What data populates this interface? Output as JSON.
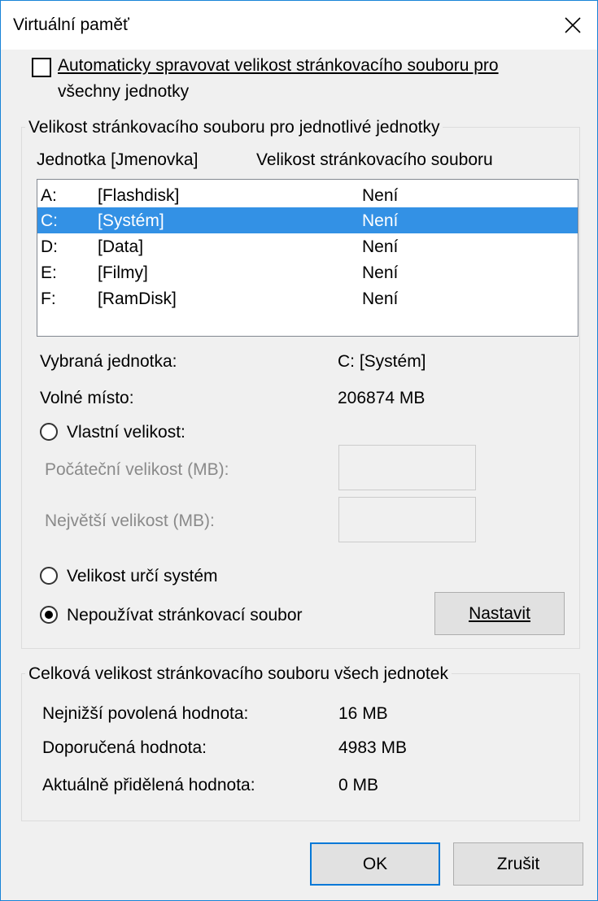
{
  "window": {
    "title": "Virtuální paměť"
  },
  "auto_manage": {
    "line1": "Automaticky spravovat velikost stránkovacího souboru pro",
    "line2": "všechny jednotky",
    "checked": false
  },
  "per_drive": {
    "group_title": "Velikost stránkovacího souboru pro jednotlivé jednotky",
    "col_drive": "Jednotka [Jmenovka]",
    "col_size": "Velikost stránkovacího souboru",
    "drives": [
      {
        "letter": "A:",
        "label": "[Flashdisk]",
        "size": "Není"
      },
      {
        "letter": "C:",
        "label": "[Systém]",
        "size": "Není"
      },
      {
        "letter": "D:",
        "label": "[Data]",
        "size": "Není"
      },
      {
        "letter": "E:",
        "label": "[Filmy]",
        "size": "Není"
      },
      {
        "letter": "F:",
        "label": "[RamDisk]",
        "size": "Není"
      }
    ],
    "selected_drive_label": "Vybraná jednotka:",
    "selected_drive_value": "C:  [Systém]",
    "free_space_label": "Volné místo:",
    "free_space_value": "206874 MB",
    "custom_size_label": "Vlastní velikost:",
    "initial_size_label": "Počáteční velikost (MB):",
    "initial_size_value": "",
    "max_size_label": "Největší velikost (MB):",
    "max_size_value": "",
    "system_managed_label": "Velikost určí systém",
    "no_paging_label": "Nepoužívat stránkovací soubor",
    "set_button": "Nastavit",
    "selected_option": "no_paging"
  },
  "totals": {
    "group_title": "Celková velikost stránkovacího souboru všech jednotek",
    "min_label": "Nejnižší povolená hodnota:",
    "min_value": "16 MB",
    "recommended_label": "Doporučená hodnota:",
    "recommended_value": "4983 MB",
    "current_label": "Aktuálně přidělená hodnota:",
    "current_value": "0 MB"
  },
  "buttons": {
    "ok": "OK",
    "cancel": "Zrušit"
  },
  "colors": {
    "selection": "#3391e5",
    "window_border": "#1883d7",
    "default_button_border": "#0078d7"
  }
}
